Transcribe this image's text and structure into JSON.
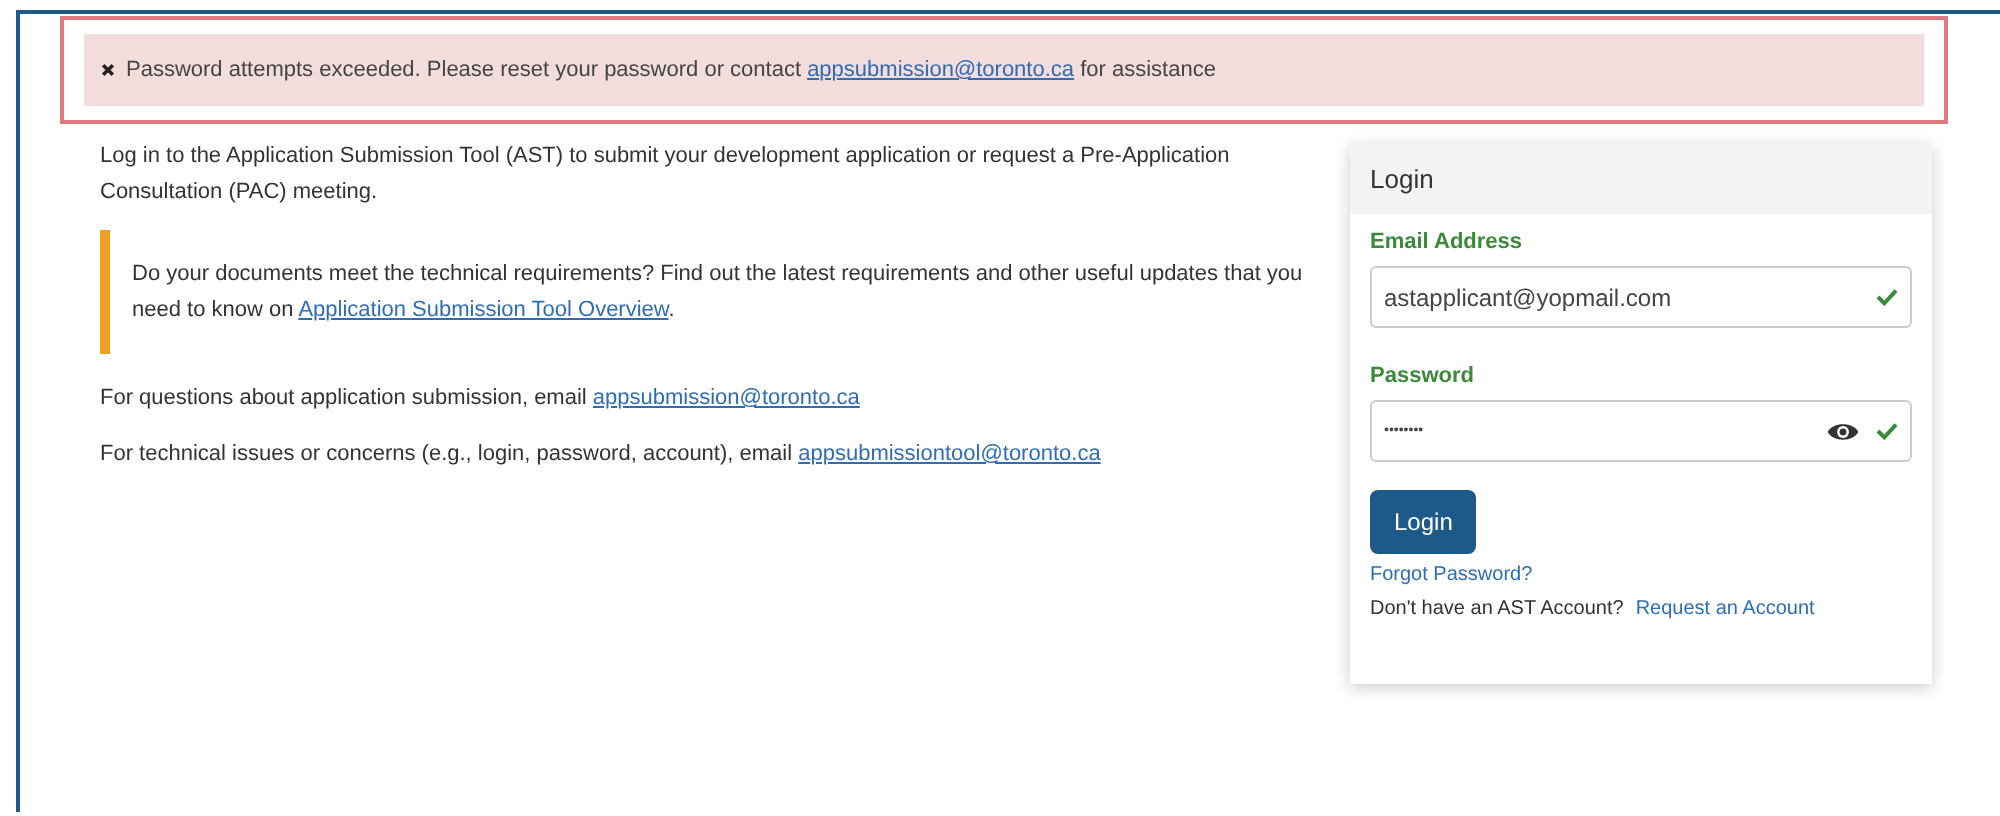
{
  "alert": {
    "kind": "error",
    "before": "Password attempts exceeded. Please reset your password or contact ",
    "link": "appsubmission@toronto.ca",
    "after": " for assistance"
  },
  "intro": "Log in to the Application Submission Tool (AST) to submit your development application or request a Pre-Application Consultation (PAC) meeting.",
  "notice": {
    "before": "Do your documents meet the technical requirements? Find out the latest requirements and other useful updates that you need to know on ",
    "link": "Application Submission Tool Overview",
    "after": "."
  },
  "contacts": [
    {
      "before": "For questions about application submission, email ",
      "link": "appsubmission@toronto.ca"
    },
    {
      "before": "For technical issues or concerns (e.g., login, password, account), email ",
      "link": "appsubmissiontool@toronto.ca"
    }
  ],
  "login": {
    "title": "Login",
    "fields": [
      {
        "label": "Email Address",
        "value": "astapplicant@yopmail.com",
        "valid": true,
        "reveal": false
      },
      {
        "label": "Password",
        "value": "••••••••",
        "valid": true,
        "reveal": true
      }
    ],
    "button": "Login",
    "forgot": "Forgot Password?",
    "signup_text": "Don't have an AST Account?",
    "signup_link": "Request an Account"
  }
}
